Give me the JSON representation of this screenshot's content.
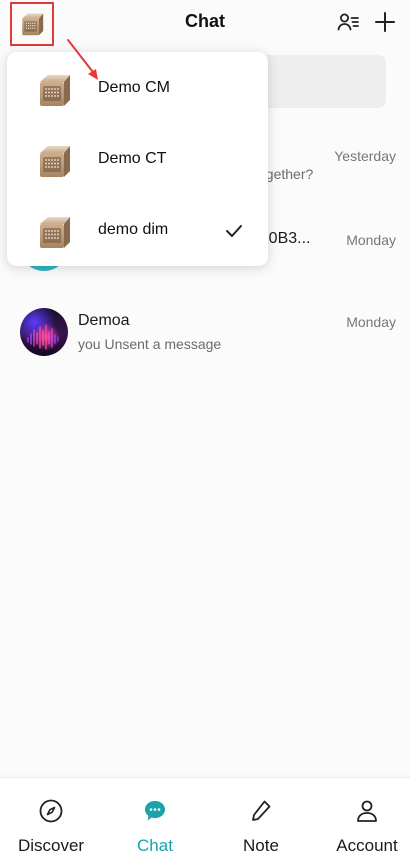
{
  "header": {
    "title": "Chat",
    "device_icon": "device-cube-icon",
    "contacts_icon": "contacts-list-icon",
    "add_icon": "plus-icon"
  },
  "dropdown": {
    "items": [
      {
        "label": "Demo CM",
        "icon": "device-cube-icon",
        "selected": false
      },
      {
        "label": "Demo CT",
        "icon": "device-cube-icon",
        "selected": false
      },
      {
        "label": "demo dim",
        "icon": "device-cube-icon",
        "selected": true
      }
    ]
  },
  "chats": [
    {
      "name": "",
      "preview": "ogether?",
      "time": "Yesterday"
    },
    {
      "name": "E0B3...",
      "preview": "",
      "time": "Monday"
    },
    {
      "name": "Demoa",
      "preview": "you Unsent a message",
      "time": "Monday"
    }
  ],
  "nav": {
    "items": [
      {
        "label": "Discover",
        "icon": "compass-icon",
        "active": false
      },
      {
        "label": "Chat",
        "icon": "chat-bubble-icon",
        "active": true
      },
      {
        "label": "Note",
        "icon": "pencil-icon",
        "active": false
      },
      {
        "label": "Account",
        "icon": "person-icon",
        "active": false
      }
    ]
  },
  "colors": {
    "accent": "#1aa3ab",
    "annotation": "#e53935",
    "background": "#fbfbfb"
  }
}
